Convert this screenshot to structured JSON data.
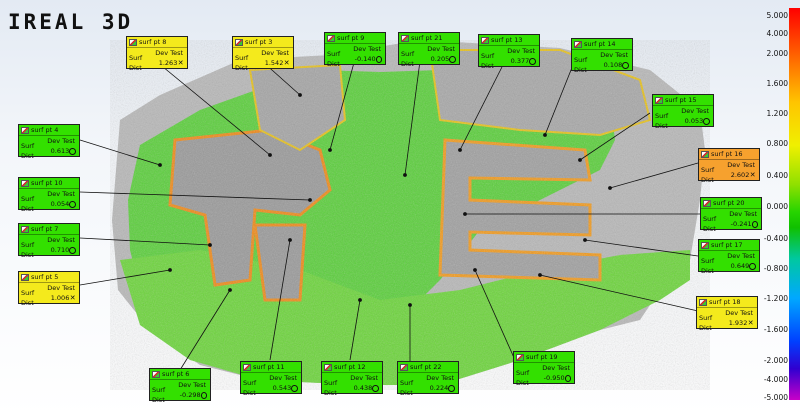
{
  "app": {
    "logo_text": "IREAL 3D"
  },
  "callout_common": {
    "dev_label": "Dev Test",
    "dist_label": "Surf Dist"
  },
  "callouts": [
    {
      "name": "surf pt 8",
      "value": "1.263",
      "status": "fail",
      "color": "yellow"
    },
    {
      "name": "surf pt 3",
      "value": "1.542",
      "status": "fail",
      "color": "yellow"
    },
    {
      "name": "surf pt 9",
      "value": "-0.140",
      "status": "ok",
      "color": "green"
    },
    {
      "name": "surf pt 21",
      "value": "0.205",
      "status": "ok",
      "color": "green"
    },
    {
      "name": "surf pt 13",
      "value": "0.377",
      "status": "ok",
      "color": "green"
    },
    {
      "name": "surf pt 14",
      "value": "0.108",
      "status": "ok",
      "color": "green"
    },
    {
      "name": "surf pt 15",
      "value": "0.053",
      "status": "ok",
      "color": "green"
    },
    {
      "name": "surf pt 4",
      "value": "0.613",
      "status": "ok",
      "color": "green"
    },
    {
      "name": "surf pt 10",
      "value": "0.054",
      "status": "ok",
      "color": "green"
    },
    {
      "name": "surf pt 16",
      "value": "2.602",
      "status": "fail",
      "color": "orange"
    },
    {
      "name": "surf pt 20",
      "value": "-0.241",
      "status": "ok",
      "color": "green"
    },
    {
      "name": "surf pt 7",
      "value": "0.710",
      "status": "ok",
      "color": "green"
    },
    {
      "name": "surf pt 17",
      "value": "0.649",
      "status": "ok",
      "color": "green"
    },
    {
      "name": "surf pt 5",
      "value": "1.006",
      "status": "fail",
      "color": "yellow"
    },
    {
      "name": "surf pt 18",
      "value": "1.932",
      "status": "fail",
      "color": "yellow"
    },
    {
      "name": "surf pt 19",
      "value": "-0.950",
      "status": "ok",
      "color": "green"
    },
    {
      "name": "surf pt 6",
      "value": "-0.298",
      "status": "ok",
      "color": "green"
    },
    {
      "name": "surf pt 11",
      "value": "0.543",
      "status": "ok",
      "color": "green"
    },
    {
      "name": "surf pt 12",
      "value": "0.438",
      "status": "ok",
      "color": "green"
    },
    {
      "name": "surf pt 22",
      "value": "0.224",
      "status": "ok",
      "color": "green"
    }
  ],
  "color_scale": {
    "ticks": [
      "5.000",
      "4.000",
      "2.000",
      "1.600",
      "1.200",
      "0.800",
      "0.400",
      "0.000",
      "-0.400",
      "-0.800",
      "-1.200",
      "-1.600",
      "-2.000",
      "-4.000",
      "-5.000"
    ]
  },
  "colors": {
    "green": "#33e000",
    "yellow": "#f4ea1c",
    "orange": "#f6a12e"
  }
}
